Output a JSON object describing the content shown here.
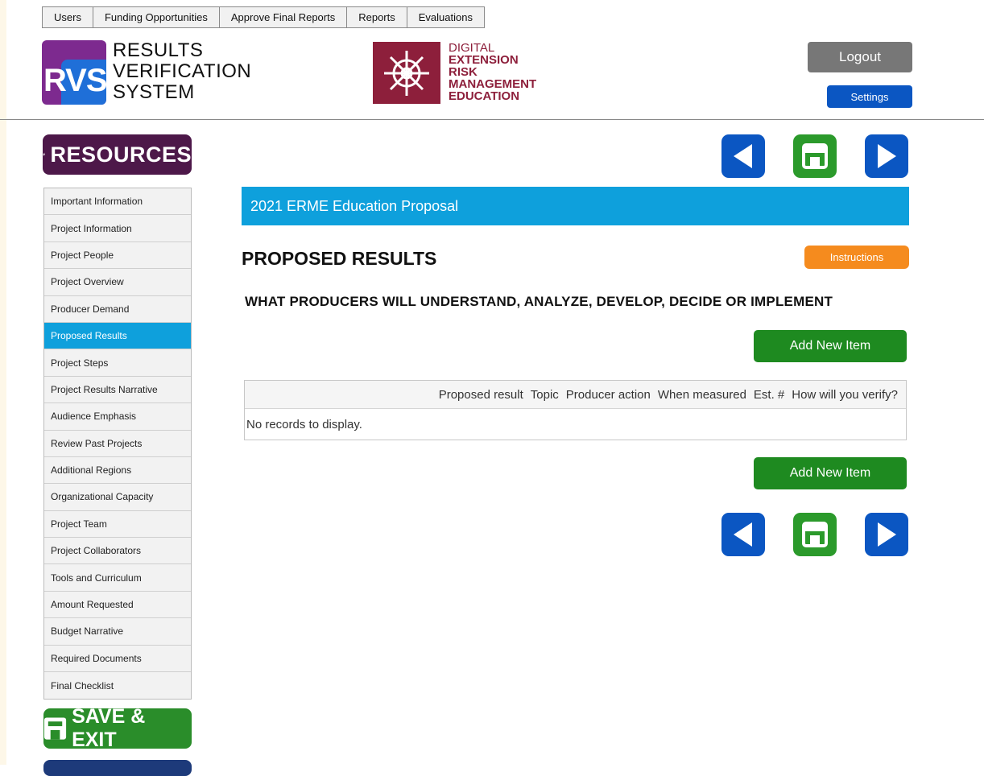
{
  "topnav": {
    "items": [
      {
        "label": "Users"
      },
      {
        "label": "Funding Opportunities"
      },
      {
        "label": "Approve Final Reports"
      },
      {
        "label": "Reports"
      },
      {
        "label": "Evaluations"
      }
    ]
  },
  "header": {
    "rvs_logo_letters": "RVS",
    "rvs_title_line1": "RESULTS",
    "rvs_title_line2": "VERIFICATION",
    "rvs_title_line3": "SYSTEM",
    "derme_line1": "DIGITAL",
    "derme_line2": "EXTENSION",
    "derme_line3": "RISK",
    "derme_line4": "MANAGEMENT",
    "derme_line5": "EDUCATION",
    "logout_label": "Logout",
    "settings_label": "Settings"
  },
  "sidebar": {
    "resources_label": "RESOURCES",
    "items": [
      {
        "label": "Important Information"
      },
      {
        "label": "Project Information"
      },
      {
        "label": "Project People"
      },
      {
        "label": "Project Overview"
      },
      {
        "label": "Producer Demand"
      },
      {
        "label": "Proposed Results",
        "active": true
      },
      {
        "label": "Project Steps"
      },
      {
        "label": "Project Results Narrative"
      },
      {
        "label": "Audience Emphasis"
      },
      {
        "label": "Review Past Projects"
      },
      {
        "label": "Additional Regions"
      },
      {
        "label": "Organizational Capacity"
      },
      {
        "label": "Project Team"
      },
      {
        "label": "Project Collaborators"
      },
      {
        "label": "Tools and Curriculum"
      },
      {
        "label": "Amount Requested"
      },
      {
        "label": "Budget Narrative"
      },
      {
        "label": "Required Documents"
      },
      {
        "label": "Final Checklist"
      }
    ],
    "save_exit_label": "SAVE & EXIT"
  },
  "main": {
    "proposal_title": "2021 ERME Education Proposal",
    "page_title": "PROPOSED RESULTS",
    "instructions_label": "Instructions",
    "section_heading": "WHAT PRODUCERS WILL UNDERSTAND, ANALYZE, DEVELOP, DECIDE OR IMPLEMENT",
    "add_new_item_label": "Add New Item",
    "grid": {
      "columns": [
        "Proposed result",
        "Topic",
        "Producer action",
        "When measured",
        "Est. #",
        "How will you verify?"
      ],
      "empty_message": "No records to display."
    }
  },
  "colors": {
    "brand_purple": "#4d1849",
    "primary_blue": "#0b56c2",
    "active_cyan": "#0ea0dc",
    "save_green": "#2b9a2b",
    "instructions_orange": "#f58b1e",
    "derme_maroon": "#8d1f3b"
  },
  "icons": {
    "resources": "lightning-bolt-icon",
    "previous": "triangle-left-icon",
    "save": "floppy-disk-icon",
    "next": "triangle-right-icon"
  }
}
